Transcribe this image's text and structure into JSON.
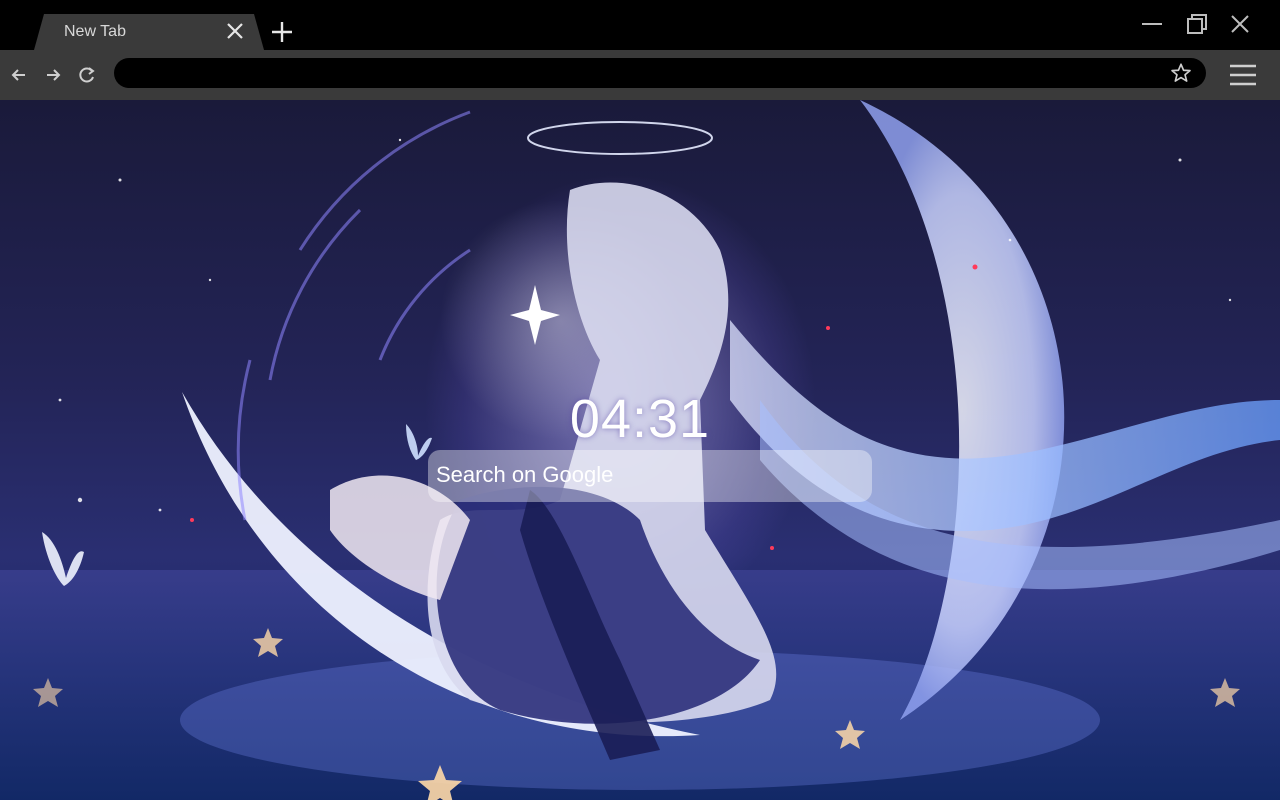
{
  "browser": {
    "tabs": [
      {
        "title": "New Tab",
        "active": true
      }
    ],
    "address_bar": {
      "value": ""
    }
  },
  "new_tab_page": {
    "clock": "04:31",
    "search": {
      "placeholder": "Search on Google"
    }
  },
  "icons": {
    "tab_close": "close-icon",
    "new_tab": "plus-icon",
    "minimize": "minimize-icon",
    "restore": "restore-icon",
    "close_window": "close-icon",
    "back": "arrow-left-icon",
    "forward": "arrow-right-icon",
    "reload": "reload-icon",
    "bookmark": "star-icon",
    "menu": "hamburger-menu-icon"
  },
  "colors": {
    "chrome_background": "#000000",
    "toolbar": "#3a3a3a",
    "sky_top": "#1a1a3a",
    "sky_bottom": "#12204f",
    "moon": "#e8ecff"
  }
}
